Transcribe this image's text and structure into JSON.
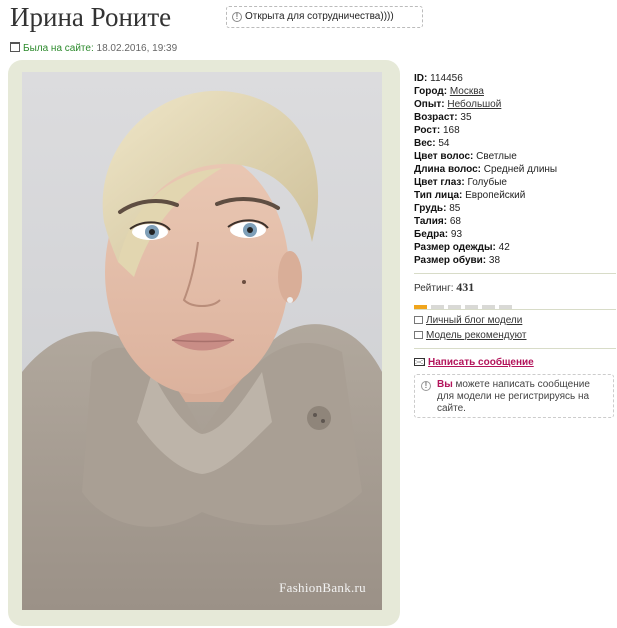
{
  "profile": {
    "name": "Ирина Роните",
    "status_badge": "Открыта для сотрудничества))))",
    "last_seen_label": "Была на сайте:",
    "last_seen_value": "18.02.2016, 19:39"
  },
  "photo": {
    "watermark": "FashionBank.ru"
  },
  "details": [
    {
      "label": "ID:",
      "value": "114456",
      "link": false
    },
    {
      "label": "Город:",
      "value": "Москва",
      "link": true
    },
    {
      "label": "Опыт:",
      "value": "Небольшой",
      "link": true
    },
    {
      "label": "Возраст:",
      "value": "35",
      "link": false
    },
    {
      "label": "Рост:",
      "value": "168",
      "link": false
    },
    {
      "label": "Вес:",
      "value": "54",
      "link": false
    },
    {
      "label": "Цвет волос:",
      "value": "Светлые",
      "link": false
    },
    {
      "label": "Длина волос:",
      "value": "Средней длины",
      "link": false
    },
    {
      "label": "Цвет глаз:",
      "value": "Голубые",
      "link": false
    },
    {
      "label": "Тип лица:",
      "value": "Европейский",
      "link": false
    },
    {
      "label": "Грудь:",
      "value": "85",
      "link": false
    },
    {
      "label": "Талия:",
      "value": "68",
      "link": false
    },
    {
      "label": "Бедра:",
      "value": "93",
      "link": false
    },
    {
      "label": "Размер одежды:",
      "value": "42",
      "link": false
    },
    {
      "label": "Размер обуви:",
      "value": "38",
      "link": false
    }
  ],
  "rating": {
    "label": "Рейтинг:",
    "value": "431",
    "segments_total": 6,
    "segments_filled": 1,
    "fill_color": "#f0a51c"
  },
  "links": {
    "blog": "Личный блог модели",
    "recommended": "Модель рекомендуют",
    "write_message": "Написать сообщение"
  },
  "notice": {
    "highlight": "Вы",
    "text": " можете написать сообщение для модели не регистрируясь на сайте."
  }
}
